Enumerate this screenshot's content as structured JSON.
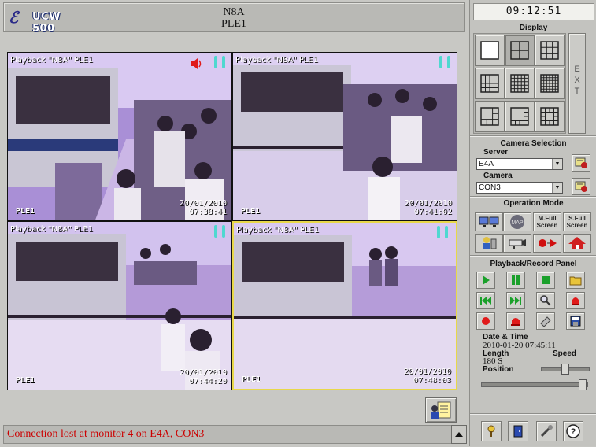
{
  "app": {
    "logo_text": "UCW 500"
  },
  "header": {
    "line1": "N8A",
    "line2": "PLE1"
  },
  "tiles": [
    {
      "label": "Playback \"N8A\" PLE1",
      "camera": "PLE1",
      "date": "20/01/2010",
      "time": "07:38:41"
    },
    {
      "label": "Playback \"N8A\" PLE1",
      "camera": "PLE1",
      "date": "20/01/2010",
      "time": "07:41:02"
    },
    {
      "label": "Playback \"N8A\" PLE1",
      "camera": "PLE1",
      "date": "20/01/2010",
      "time": "07:44:20"
    },
    {
      "label": "Playback \"N8A\" PLE1",
      "camera": "PLE1",
      "date": "20/01/2010",
      "time": "07:48:03"
    }
  ],
  "status": {
    "message": "Connection lost at monitor 4 on E4A, CON3",
    "color": "#cc0000"
  },
  "panel": {
    "clock": "09:12:51",
    "display_title": "Display",
    "ext_label": [
      "E",
      "X",
      "T"
    ],
    "camera_selection_title": "Camera Selection",
    "server_label": "Server",
    "server_value": "E4A",
    "camera_label": "Camera",
    "camera_value": "CON3",
    "operation_title": "Operation Mode",
    "m_full_label": "M.Full Screen",
    "s_full_label": "S.Full Screen",
    "map_label": "MAP",
    "playback_title": "Playback/Record Panel",
    "date_time_label": "Date & Time",
    "date_time_value": "2010-01-20 07:45:11",
    "length_label": "Length",
    "length_value": "180 S",
    "speed_label": "Speed",
    "position_label": "Position"
  },
  "icons": {
    "play": "play-icon",
    "pause": "pause-icon",
    "stop": "stop-icon",
    "open": "folder-icon",
    "rewind": "rewind-icon",
    "forward": "fast-forward-icon",
    "zoom": "zoom-icon",
    "alarm": "alarm-icon",
    "record": "record-icon",
    "alarm_record": "alarm-record-icon",
    "snapshot": "snapshot-icon",
    "save": "save-icon"
  }
}
